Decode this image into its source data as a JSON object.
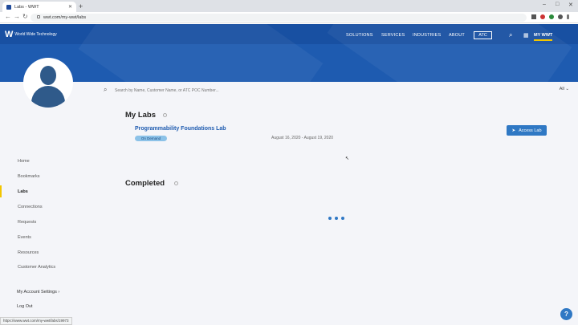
{
  "browser": {
    "tab_title": "Labs - WWT",
    "url": "wwt.com/my-wwt/labs",
    "status_url": "https://www.wwt.com/my-wwt/labs/19973"
  },
  "header": {
    "brand": "World Wide Technology",
    "menu": [
      "SOLUTIONS",
      "SERVICES",
      "INDUSTRIES",
      "ABOUT"
    ],
    "atc": "ATC",
    "my_wwt": "MY WWT"
  },
  "search": {
    "placeholder": "Search by Name, Customer Name, or ATC POC Number...",
    "filter": "All"
  },
  "sidebar": {
    "items": [
      "Home",
      "Bookmarks",
      "Labs",
      "Connections",
      "Requests",
      "Events",
      "Resources",
      "Customer Analytics"
    ],
    "active": "Labs",
    "account_settings": "My Account Settings",
    "log_out": "Log Out"
  },
  "my_labs": {
    "title": "My Labs",
    "lab_name": "Programmability Foundations Lab",
    "badge": "On Demand",
    "dates": "August 16, 2020 - August 19, 2020",
    "access_label": "Access Lab"
  },
  "completed": {
    "title": "Completed"
  },
  "help_icon": "?",
  "colors": {
    "brand_blue": "#1e5bb0",
    "accent_yellow": "#f2c500",
    "button_blue": "#2f78c4"
  }
}
